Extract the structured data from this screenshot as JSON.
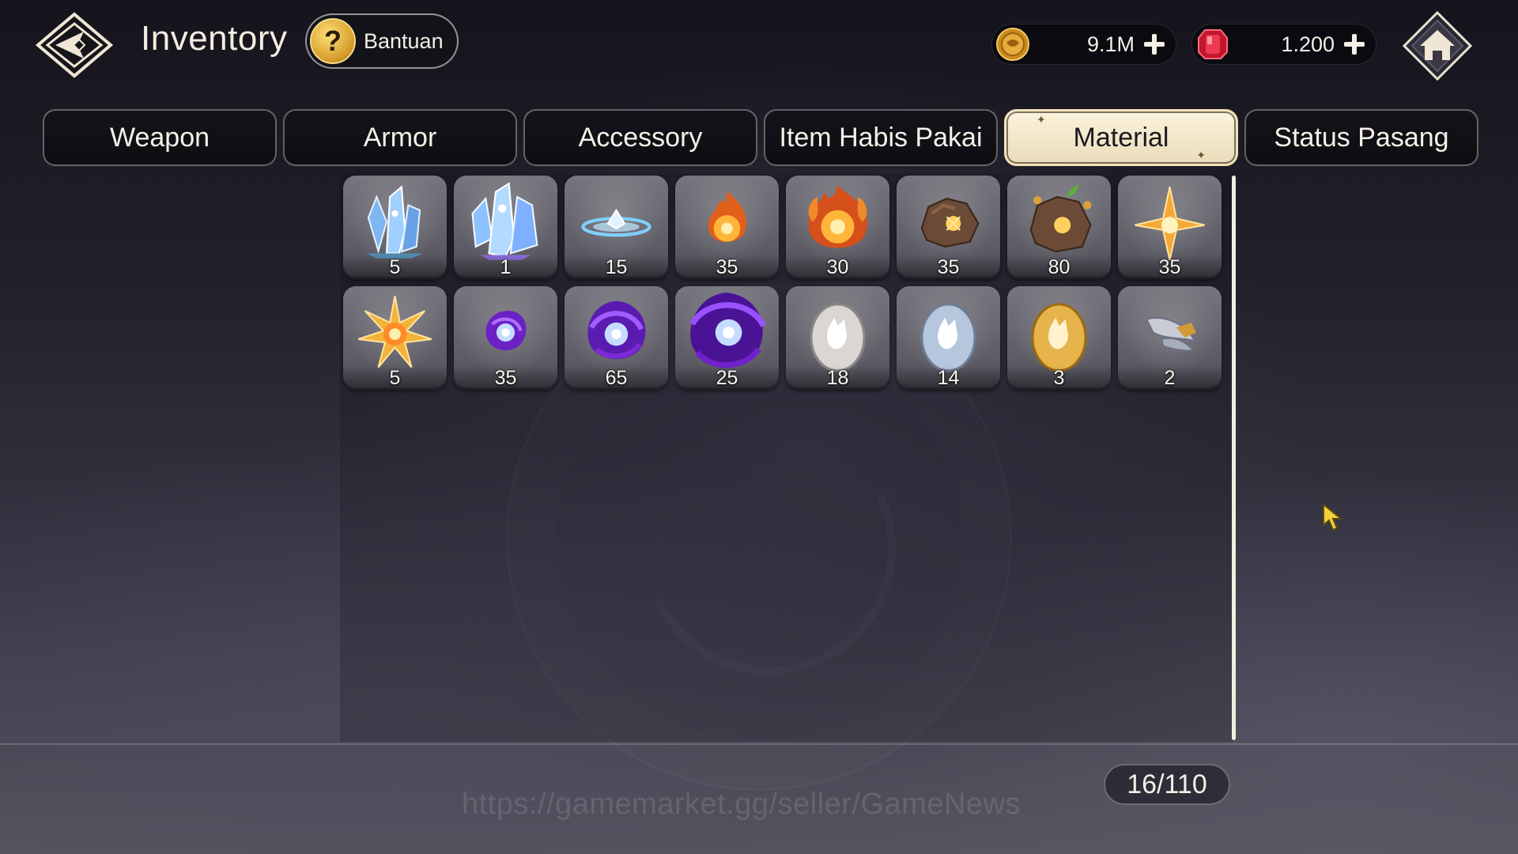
{
  "header": {
    "title": "Inventory",
    "help_label": "Bantuan",
    "help_icon": "question-icon",
    "back_icon": "diamond-back-icon",
    "home_icon": "home-icon"
  },
  "currencies": {
    "gold": {
      "value": "9.1M",
      "icon": "gold-coin-icon"
    },
    "gem": {
      "value": "1.200",
      "icon": "red-gem-icon"
    }
  },
  "tabs": [
    {
      "label": "Weapon",
      "active": false
    },
    {
      "label": "Armor",
      "active": false
    },
    {
      "label": "Accessory",
      "active": false
    },
    {
      "label": "Item Habis Pakai",
      "active": false
    },
    {
      "label": "Material",
      "active": true
    },
    {
      "label": "Status Pasang",
      "active": false
    }
  ],
  "items": [
    {
      "icon": "blue-crystal-small-icon",
      "qty": "5"
    },
    {
      "icon": "blue-crystal-large-icon",
      "qty": "1"
    },
    {
      "icon": "floating-crystal-disc-icon",
      "qty": "15"
    },
    {
      "icon": "fire-orb-small-icon",
      "qty": "35"
    },
    {
      "icon": "fire-orb-large-icon",
      "qty": "30"
    },
    {
      "icon": "ore-rock-icon",
      "qty": "35"
    },
    {
      "icon": "ore-rock-sprout-icon",
      "qty": "80"
    },
    {
      "icon": "gold-star-sparkle-icon",
      "qty": "35"
    },
    {
      "icon": "gold-star-burst-icon",
      "qty": "5"
    },
    {
      "icon": "void-orb-small-icon",
      "qty": "35"
    },
    {
      "icon": "void-orb-medium-icon",
      "qty": "65"
    },
    {
      "icon": "void-orb-large-icon",
      "qty": "25"
    },
    {
      "icon": "silver-egg-icon",
      "qty": "18"
    },
    {
      "icon": "blue-silver-egg-icon",
      "qty": "14"
    },
    {
      "icon": "gold-egg-icon",
      "qty": "3"
    },
    {
      "icon": "feather-wing-icon",
      "qty": "2"
    }
  ],
  "footer": {
    "capacity": "16/110",
    "watermark": "https://gamemarket.gg/seller/GameNews"
  },
  "colors": {
    "tab_active_bg": "#fbf3dc",
    "tab_bg": "#14131a",
    "slot_bg": "#6a6870",
    "gold": "#e0a12b",
    "gem": "#d8223a",
    "void": "#7a2bd6"
  }
}
